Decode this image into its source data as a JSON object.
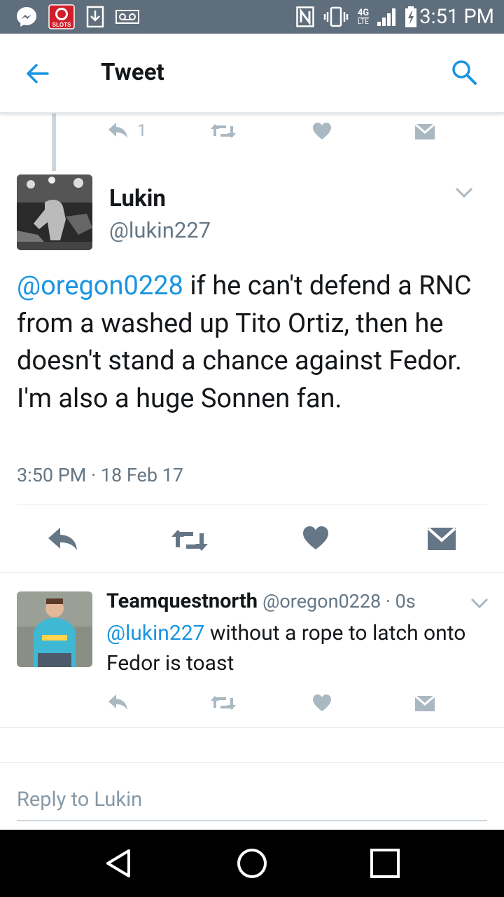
{
  "status_bar": {
    "time": "3:51 PM",
    "icons": [
      "messenger-icon",
      "slots-app-icon",
      "download-icon",
      "voicemail-icon",
      "nfc-icon",
      "vibrate-icon",
      "4g-lte-icon",
      "signal-icon",
      "battery-charging-icon"
    ],
    "slots_label": "SLOTS",
    "network_label": "4G"
  },
  "header": {
    "title": "Tweet",
    "back_icon": "arrow-left-icon",
    "search_icon": "search-icon"
  },
  "parent_actions": {
    "reply_count": "1"
  },
  "main_tweet": {
    "name": "Lukin",
    "handle": "@lukin227",
    "mention": "@oregon0228",
    "text": " if he can't defend a RNC from a washed up Tito Ortiz, then he doesn't stand a chance against Fedor.  I'm also a huge Sonnen fan.",
    "meta": "3:50 PM · 18 Feb 17"
  },
  "reply_tweet": {
    "name": "Teamquestnorth",
    "handle_time": "@oregon0228 · 0s",
    "mention": "@lukin227",
    "text": " without a rope to latch onto Fedor is toast"
  },
  "reply_box": {
    "placeholder": "Reply to Lukin"
  },
  "colors": {
    "accent": "#1b95e0",
    "status_bar": "#5f6e7c",
    "action_gray": "#aab8c2",
    "action_dark": "#657786",
    "secondary_text": "#657786"
  }
}
